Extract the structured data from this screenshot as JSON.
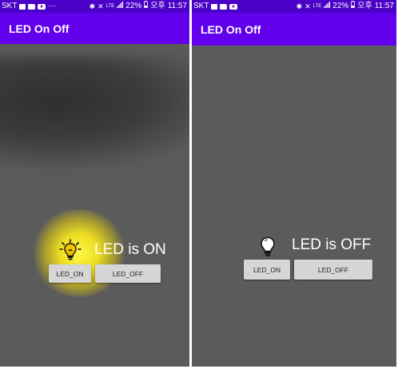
{
  "status_bar": {
    "carrier": "SKT",
    "dots": "···",
    "lte": "LTE",
    "battery": "22%",
    "ampm": "오후",
    "time": "11:57"
  },
  "app": {
    "title": "LED On Off"
  },
  "left_screen": {
    "led_state": "on",
    "status_text": "LED is ON",
    "on_button": "LED_ON",
    "off_button": "LED_OFF"
  },
  "right_screen": {
    "led_state": "off",
    "status_text": "LED is OFF",
    "on_button": "LED_ON",
    "off_button": "LED_OFF"
  },
  "colors": {
    "status_bar": "#4a00c6",
    "app_bar": "#6200ee",
    "background": "#5b5b5b",
    "button": "#d6d6d6",
    "bulb_on": "#f5c400",
    "glow": "#f5e41e"
  },
  "icons": [
    "image-icon",
    "folder-icon",
    "youtube-icon",
    "bluetooth-icon",
    "mute-icon",
    "signal-icon",
    "battery-icon",
    "lightbulb-on-icon",
    "lightbulb-off-icon"
  ]
}
